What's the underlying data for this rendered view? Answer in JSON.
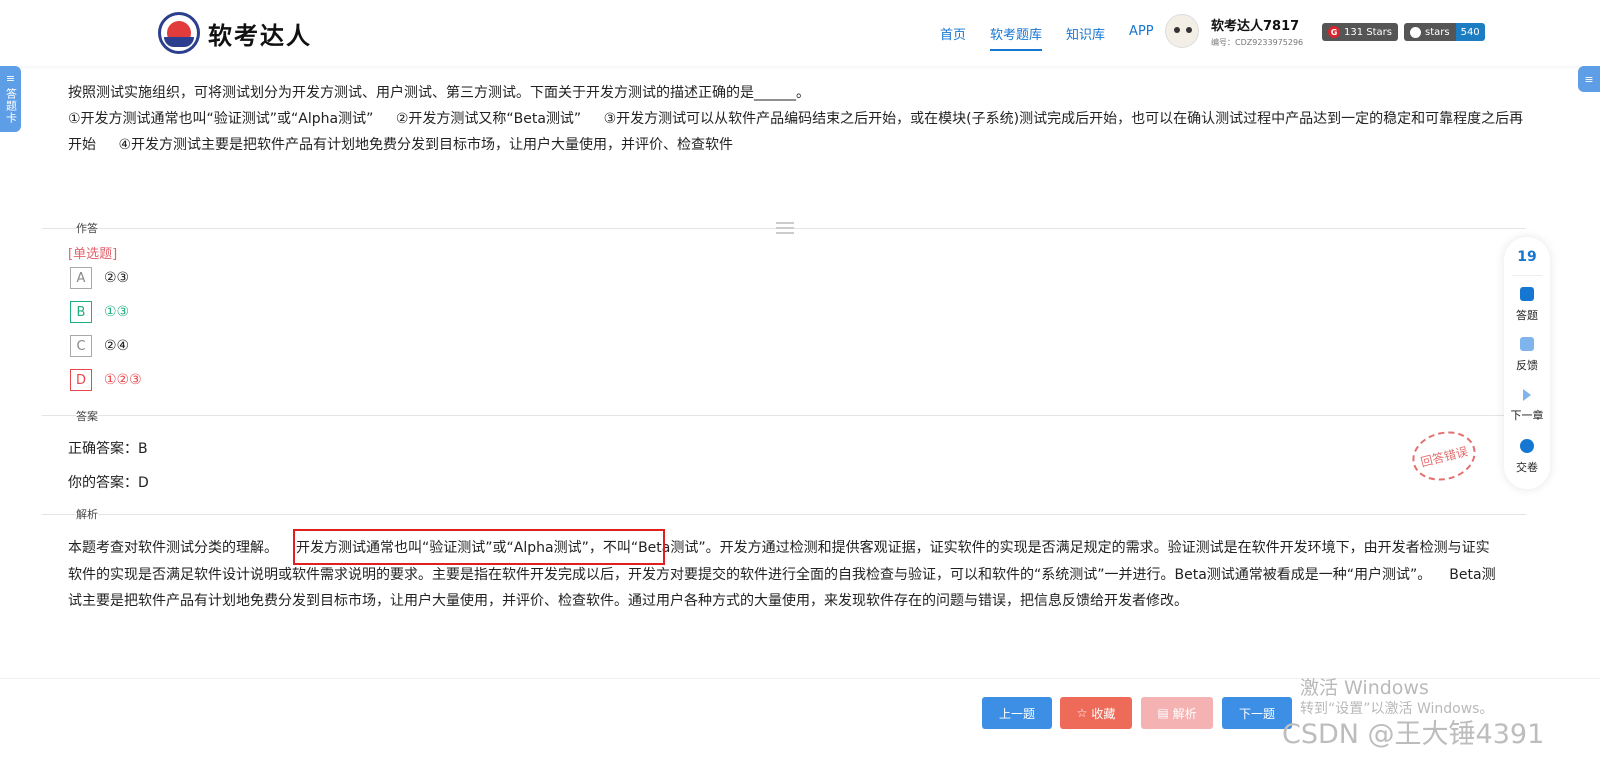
{
  "header": {
    "logo_text": "软考达人",
    "nav": [
      "首页",
      "软考题库",
      "知识库",
      "APP"
    ],
    "active_nav": "软考题库",
    "user_name": "软考达人7817",
    "user_id": "编号：CDZ9233975296",
    "badges": [
      {
        "left": "131 Stars",
        "right": ""
      },
      {
        "left": "stars",
        "right": "540"
      }
    ]
  },
  "side": {
    "answer_card": "答题卡"
  },
  "question": {
    "line1": "按照测试实施组织，可将测试划分为开发方测试、用户测试、第三方测试。下面关于开发方测试的描述正确的是______。",
    "s1": "①开发方测试通常也叫“验证测试”或“Alpha测试”",
    "s2": "②开发方测试又称“Beta测试”",
    "s3": "③开发方测试可以从软件产品编码结束之后开始，或在模块(子系统)测试完成后开始，也可以在确认测试过程中产品达到一定的稳定和可靠程度之后再开始",
    "s4": "④开发方测试主要是把软件产品有计划地免费分发到目标市场，让用户大量使用，并评价、检查软件"
  },
  "sections": {
    "answer_area": "作答",
    "answer": "答案",
    "analysis": "解析"
  },
  "question_type": "[单选题]",
  "options": [
    {
      "letter": "A",
      "text": "②③",
      "state": "normal"
    },
    {
      "letter": "B",
      "text": "①③",
      "state": "correct"
    },
    {
      "letter": "C",
      "text": "②④",
      "state": "normal"
    },
    {
      "letter": "D",
      "text": "①②③",
      "state": "wrong"
    }
  ],
  "answer": {
    "correct_label": "正确答案：B",
    "your_label": "你的答案：D"
  },
  "stamp": "回答错误",
  "analysis": {
    "p1": "本题考查对软件测试分类的理解。",
    "p2": "开发方测试通常也叫“验证测试”或“Alpha测试”，",
    "p3": "不叫“Beta测试”。开发方通过检测和提供客观证据，证实软件的实现是否满足规定的需求。验证测试是在软件开发环境下，由开发者检测与证实软件的实现是否满足软件设计说明或软件需求说明的要求。主要是指在软件开发完成以后，开发方对要提交的软件进行全面的自我检查与验证，可以和软件的“系统测试”一并进行。Beta测试通常被看成是一种“用户测试”。",
    "p4": "Beta测试主要是把软件产品有计划地免费分发到目标市场，让用户大量使用，并评价、检查软件。通过用户各种方式的大量使用，来发现软件存在的问题与错误，把信息反馈给开发者修改。"
  },
  "float_panel": {
    "count": "19",
    "items": [
      "答题",
      "反馈",
      "下一章",
      "交卷"
    ]
  },
  "buttons": {
    "prev": "上一题",
    "fav": "收藏",
    "analysis": "解析",
    "next": "下一题"
  },
  "watermark": {
    "line1": "激活 Windows",
    "line2": "转到“设置”以激活 Windows。",
    "csdn": "CSDN @王大锤4391"
  },
  "colors": {
    "primary": "#1677d2",
    "correct": "#21b07c",
    "wrong": "#e9474c",
    "highlight": "#e02020"
  }
}
